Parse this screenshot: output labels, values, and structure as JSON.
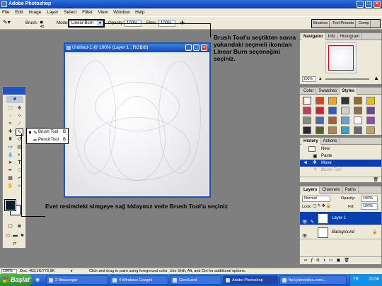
{
  "window": {
    "title": "Adobe Photoshop"
  },
  "menu": [
    "File",
    "Edit",
    "Image",
    "Layer",
    "Select",
    "Filter",
    "View",
    "Window",
    "Help"
  ],
  "options": {
    "brush_label": "Brush:",
    "brush_size": "45",
    "mode_label": "Mode:",
    "mode_value": "Linear Burn",
    "opacity_label": "Opacity:",
    "opacity_value": "100%",
    "flow_label": "Flow:",
    "flow_value": "100%",
    "wells": [
      "Brushes",
      "Tool Presets",
      "Comp"
    ]
  },
  "document": {
    "title": "Untitled-1 @ 100% (Layer 1 , RGB/8)"
  },
  "flyout": {
    "items": [
      {
        "label": "Brush Tool",
        "key": "B"
      },
      {
        "label": "Pencil Tool",
        "key": "B"
      }
    ]
  },
  "annotations": {
    "top": "Brush Tool'u seçtikten sonra yukarıdaki seçmeli ikondan Linear Burn seçeneğini seçiniz.",
    "bottom": "Evet resimdeki simgeye sağ tıklayınız vede Brush Tool'u seçiniz"
  },
  "navigator": {
    "tabs": [
      "Navigator",
      "Info",
      "Histogram"
    ],
    "zoom": "100%"
  },
  "styles": {
    "tabs": [
      "Color",
      "Swatches",
      "Styles"
    ],
    "colors": [
      "#ffffff",
      "#d04a2a",
      "#e8a33a",
      "#333333",
      "#9a6a2a",
      "#e0c020",
      "#c04060",
      "#cc2233",
      "#3a5ab0",
      "#d0d0d0",
      "#8a7050",
      "#6a4a8a",
      "#888888",
      "#4a6ab0",
      "#a06040",
      "#6aa0d0",
      "#ffffff",
      "#9050a0",
      "#2a2a2a",
      "#506030",
      "#b08060",
      "#40a0c0",
      "#6a6a6a",
      "#c0a070"
    ]
  },
  "history": {
    "tabs": [
      "History",
      "Actions"
    ],
    "items": [
      "New",
      "Paste",
      "Move",
      "Brush Tool"
    ],
    "selected_index": 2
  },
  "layers": {
    "tabs": [
      "Layers",
      "Channels",
      "Paths"
    ],
    "blend": "Normal",
    "opacity_label": "Opacity:",
    "opacity": "100%",
    "lock_label": "Lock:",
    "fill_label": "Fill:",
    "fill": "100%",
    "items": [
      "Layer 1",
      "Background"
    ]
  },
  "status": {
    "zoom": "100%",
    "doc": "Doc: 403,1K/773,9K",
    "hint": "Click and drag to paint using foreground color.  Use Shift, Alt, and Ctrl for additional options."
  },
  "taskbar": {
    "start": "Başlat",
    "tasks": [
      "2 Messenger",
      "4 Windows Gezgini",
      "GencLand",
      "Adobe Photoshop",
      "ftp://ydmobilya.com/..."
    ],
    "active_index": 3,
    "lang": "TR",
    "clock": "20:06"
  }
}
